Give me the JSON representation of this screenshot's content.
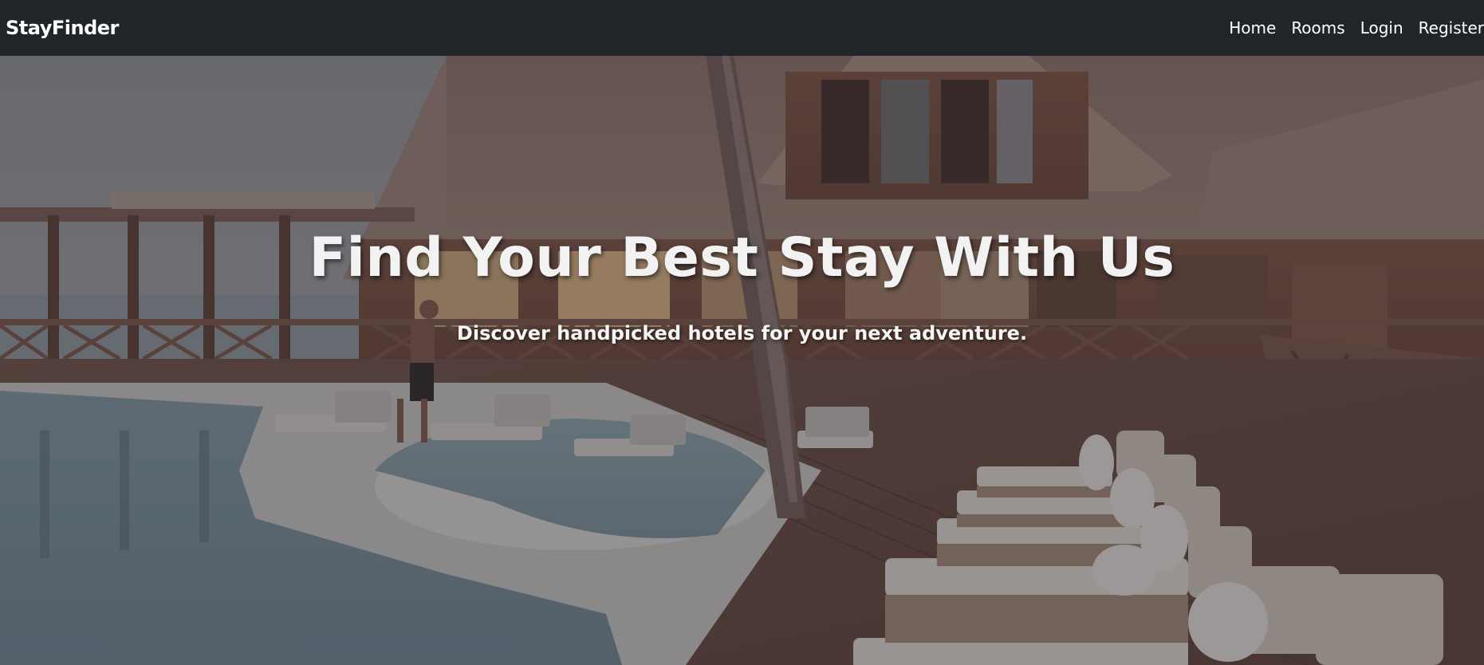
{
  "navbar": {
    "brand": "StayFinder",
    "links": [
      {
        "label": "Home"
      },
      {
        "label": "Rooms"
      },
      {
        "label": "Login"
      },
      {
        "label": "Register"
      }
    ]
  },
  "hero": {
    "title": "Find Your Best Stay With Us",
    "subtitle": "Discover handpicked hotels for your next adventure.",
    "background_image": "resort-pool-deck-photo"
  },
  "colors": {
    "navbar_bg": "#212529",
    "nav_text": "#ffffff",
    "hero_text": "#f2f2f2"
  }
}
